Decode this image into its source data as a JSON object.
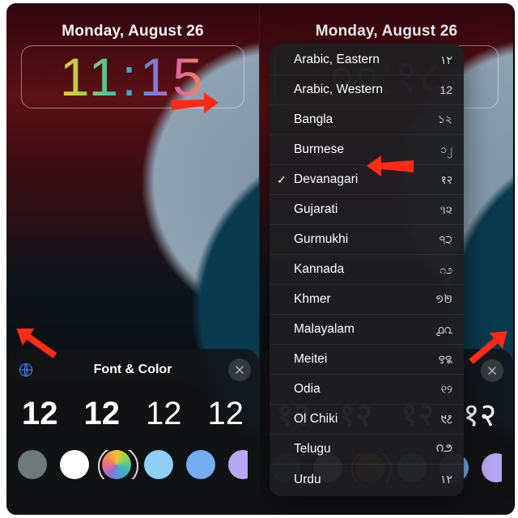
{
  "left": {
    "date": "Monday, August 26",
    "time": "11:15",
    "sheet_title": "Font & Color",
    "font_samples": [
      "12",
      "12",
      "12",
      "12"
    ],
    "swatches": [
      "#6f7a78",
      "#ffffff",
      "rainbow",
      "#8fcff6",
      "#74aef0",
      "#b6a8f2",
      "#d9bff0"
    ]
  },
  "right": {
    "date": "Monday, August 26",
    "time": "००:१८",
    "font_samples": [
      "१२",
      "१२",
      "१२",
      "१२"
    ],
    "swatches": [
      "#6f7a78",
      "#ffffff",
      "rainbow",
      "#8fcff6",
      "#74aef0",
      "#b6a8f2",
      "#d9bff0"
    ],
    "numerals": [
      {
        "label": "Arabic, Eastern",
        "sample": "١٢",
        "selected": false
      },
      {
        "label": "Arabic, Western",
        "sample": "12",
        "selected": false
      },
      {
        "label": "Bangla",
        "sample": "১২",
        "selected": false
      },
      {
        "label": "Burmese",
        "sample": "၁၂",
        "selected": false
      },
      {
        "label": "Devanagari",
        "sample": "१२",
        "selected": true
      },
      {
        "label": "Gujarati",
        "sample": "૧૨",
        "selected": false
      },
      {
        "label": "Gurmukhi",
        "sample": "੧੨",
        "selected": false
      },
      {
        "label": "Kannada",
        "sample": "೧೨",
        "selected": false
      },
      {
        "label": "Khmer",
        "sample": "១២",
        "selected": false
      },
      {
        "label": "Malayalam",
        "sample": "൧൨",
        "selected": false
      },
      {
        "label": "Meitei",
        "sample": "꯱꯲",
        "selected": false
      },
      {
        "label": "Odia",
        "sample": "୧୨",
        "selected": false
      },
      {
        "label": "Ol Chiki",
        "sample": "᱑᱒",
        "selected": false
      },
      {
        "label": "Telugu",
        "sample": "౧౨",
        "selected": false
      },
      {
        "label": "Urdu",
        "sample": "۱۲",
        "selected": false
      }
    ]
  }
}
